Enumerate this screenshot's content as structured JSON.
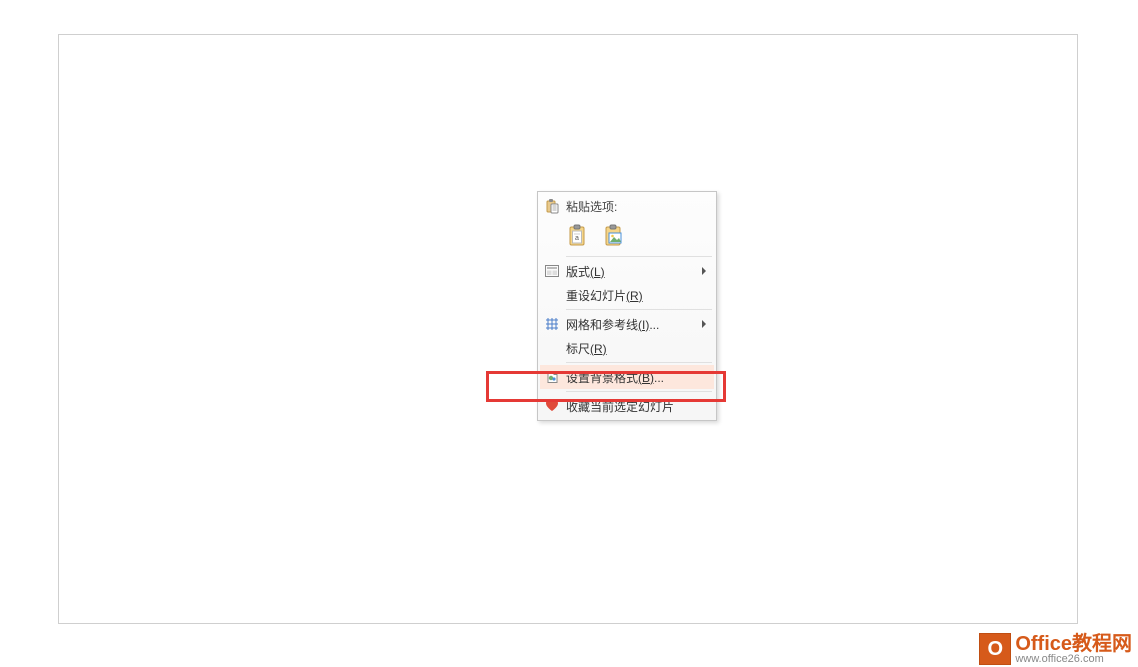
{
  "menu": {
    "paste_header": "粘贴选项:",
    "paste_option_1_name": "paste-keep-formatting",
    "paste_option_2_name": "paste-as-picture",
    "layout": {
      "label": "版式",
      "hotkey": "(L)"
    },
    "reset_slide": {
      "label": "重设幻灯片",
      "hotkey": "(R)"
    },
    "grid_guides": {
      "label": "网格和参考线",
      "hotkey": "(I)",
      "suffix": "..."
    },
    "ruler": {
      "label": "标尺",
      "hotkey": "(R)"
    },
    "format_background": {
      "label": "设置背景格式",
      "hotkey": "(B)",
      "suffix": "..."
    },
    "favorite_slide": {
      "label": "收藏当前选定幻灯片"
    }
  },
  "watermark": {
    "title": "Office教程网",
    "url": "www.office26.com",
    "icon_letter": "O"
  }
}
